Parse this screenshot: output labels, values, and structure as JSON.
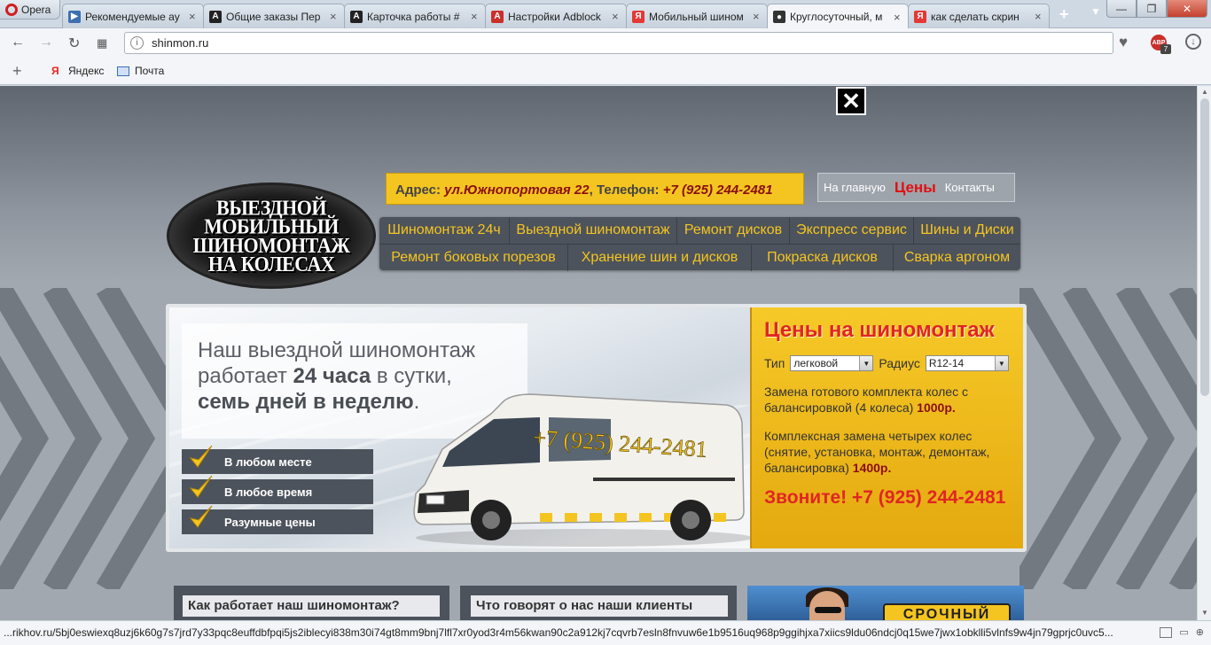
{
  "browser": {
    "menu_label": "Opera",
    "tabs": [
      {
        "title": "Рекомендуемые ау",
        "icon": "video-icon",
        "icon_color": "#3d6fb1",
        "icon_char": "▶"
      },
      {
        "title": "Общие заказы Пер",
        "icon": "letter-a-icon",
        "icon_color": "#222222",
        "icon_char": "A"
      },
      {
        "title": "Карточка работы #",
        "icon": "letter-a-icon",
        "icon_color": "#222222",
        "icon_char": "A"
      },
      {
        "title": "Настройки Adblock",
        "icon": "abp-icon",
        "icon_color": "#c9302c",
        "icon_char": "A"
      },
      {
        "title": "Мобильный шином",
        "icon": "yandex-icon",
        "icon_color": "#e53935",
        "icon_char": "Я"
      },
      {
        "title": "Круглосуточный, м",
        "icon": "site-icon",
        "icon_color": "#333333",
        "icon_char": "●"
      },
      {
        "title": "как сделать скрин",
        "icon": "yandex-icon",
        "icon_color": "#e53935",
        "icon_char": "Я"
      }
    ],
    "active_tab": 5,
    "url": "shinmon.ru",
    "abp_badge": "7",
    "bookmarks": [
      {
        "label": "Яндекс",
        "icon": "yandex-icon"
      },
      {
        "label": "Почта",
        "icon": "mail-icon"
      }
    ],
    "status_url": "...rikhov.ru/5bj0eswiexq8uzj6k60g7s7jrd7y33pqc8euffdbfpqi5js2iblecyi838m30i74gt8mm9bnj7lfl7xr0yod3r4m56kwan90c2a912kj7cqvrb7esln8fnvuw6e1b9516uq968p9ggihjxa7xiics9ldu06ndcj0q15we7jwx1obklli5vlnfs9w4jn79gprjc0uvc5..."
  },
  "site": {
    "logo_lines": [
      "ВЫЕЗДНОЙ",
      "МОБИЛЬНЫЙ",
      "ШИНОМОНТАЖ",
      "НА КОЛЕСАХ"
    ],
    "address_label": "Адрес:",
    "address_value": "ул.Южнопортовая 22",
    "phone_label": "Телефон:",
    "phone_value": "+7 (925) 244-2481",
    "topnav": [
      "На главную",
      "Цены",
      "Контакты"
    ],
    "menu_row1": [
      {
        "label": "Шиномонтаж 24ч",
        "w": 147
      },
      {
        "label": "Выездной шиномонтаж",
        "w": 189
      },
      {
        "label": "Ремонт дисков",
        "w": 127
      },
      {
        "label": "Экспресс сервис",
        "w": 140
      },
      {
        "label": "Шины и Диски",
        "w": 120
      }
    ],
    "menu_row2": [
      {
        "label": "Ремонт боковых порезов",
        "w": 213
      },
      {
        "label": "Хранение шин и дисков",
        "w": 207
      },
      {
        "label": "Покраска дисков",
        "w": 160
      },
      {
        "label": "Сварка аргоном",
        "w": 143
      }
    ],
    "banner": {
      "line1": "Наш выездной шиномонтаж",
      "line2a": "работает ",
      "line2b": "24 часа",
      "line2c": " в сутки,",
      "line3": "семь дней в неделю",
      "line3_end": ".",
      "features": [
        "В любом месте",
        "В любое время",
        "Разумные цены"
      ],
      "van_phone": "+7 (925) 244-2481"
    },
    "prices": {
      "title": "Цены на шиномонтаж",
      "type_label": "Тип",
      "type_value": "легковой",
      "radius_label": "Радиус",
      "radius_value": "R12-14",
      "item1_text": "Замена готового комплекта колес с балансировкой (4 колеса) ",
      "item1_price": "1000р.",
      "item2_text": "Комплексная замена четырех колес (снятие, установка, монтаж, демонтаж, балансировка) ",
      "item2_price": "1400р.",
      "call": "Звоните! +7 (925) 244-2481"
    },
    "blocks": [
      "Как работает наш шиномонтаж?",
      "Что говорят о нас наши клиенты"
    ],
    "urgent_sign": "СРОЧНЫЙ"
  }
}
